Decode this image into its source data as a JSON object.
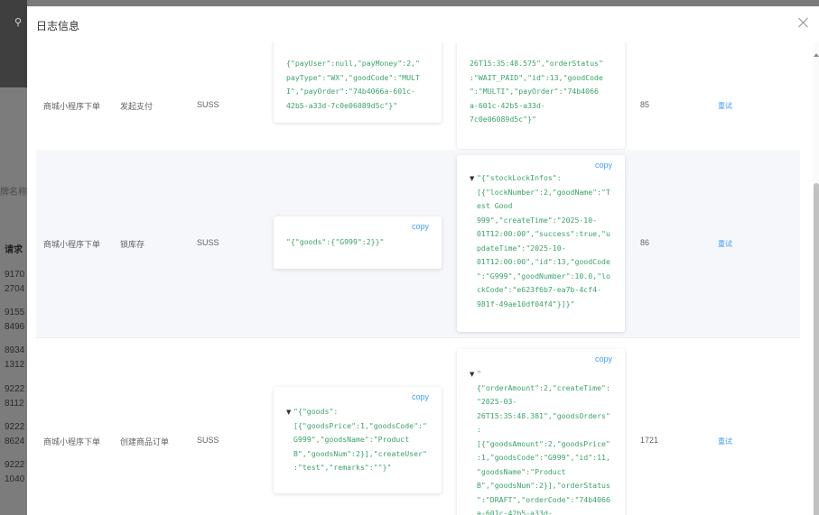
{
  "background": {
    "search_icon": "search-icon",
    "placeholder_fragment": "牌名称",
    "column_header_fragment": "请求",
    "id_fragments": [
      "9170",
      "2704",
      "9155",
      "8496",
      "8934",
      "1312",
      "9222",
      "8112",
      "9222",
      "8624",
      "9222",
      "1040"
    ]
  },
  "modal": {
    "title": "日志信息",
    "copy_label": "copy",
    "rows": [
      {
        "source": "商城小程序下单",
        "action": "发起支付",
        "status": "SUSS",
        "request_json": "{\"payUser\":null,\"payMoney\":2,\"\npayType\":\"WX\",\"goodCode\":\"MULT\nI\",\"payOrder\":\"74b4066a-601c-\n42b5-a33d-7c0e06089d5c\"}\"",
        "response_json": "26T15:35:48.575\",\"orderStatus\"\n:\"WAIT_PAID\",\"id\":13,\"goodCode\n\":\"MULTI\",\"payOrder\":\"74b4066\na-601c-42b5-a33d-\n7c0e06089d5c\"}\"",
        "duration": "85",
        "op": "重试"
      },
      {
        "source": "商城小程序下单",
        "action": "锁库存",
        "status": "SUSS",
        "request_json": "\"{\"goods\":{\"G999\":2}}\"",
        "response_json": "\"{\"stockLockInfos\":\n[{\"lockNumber\":2,\"goodName\":\"T\nest Good\n999\",\"createTime\":\"2025-10-\n01T12:00:00\",\"success\":true,\"u\npdateTime\":\"2025-10-\n01T12:00:00\",\"id\":13,\"goodCode\n\":\"G999\",\"goodNumber\":10.0,\"lo\nckCode\":\"e623f6b7-ea7b-4cf4-\n981f-49ae10df04f4\"}]}\"",
        "duration": "86",
        "op": "重试"
      },
      {
        "source": "商城小程序下单",
        "action": "创建商品订单",
        "status": "SUSS",
        "request_json": "\"{\"goods\":\n[{\"goodsPrice\":1,\"goodsCode\":\"\nG999\",\"goodsName\":\"Product\nB\",\"goodsNum\":2}],\"createUser\"\n:\"test\",\"remarks\":\"\"}\"",
        "response_json": "\"\n{\"orderAmount\":2,\"createTime\":\n\"2025-03-\n26T15:35:48.381\",\"goodsOrders\"\n:\n[{\"goodsAmount\":2,\"goodsPrice\"\n:1,\"goodsCode\":\"G999\",\"id\":11,\n\"goodsName\":\"Product\nB\",\"goodsNum\":2}],\"orderStatus\n\":\"DRAFT\",\"orderCode\":\"74b4066\na-601c-42b5-a33d-",
        "duration": "1721",
        "op": "重试"
      }
    ]
  }
}
